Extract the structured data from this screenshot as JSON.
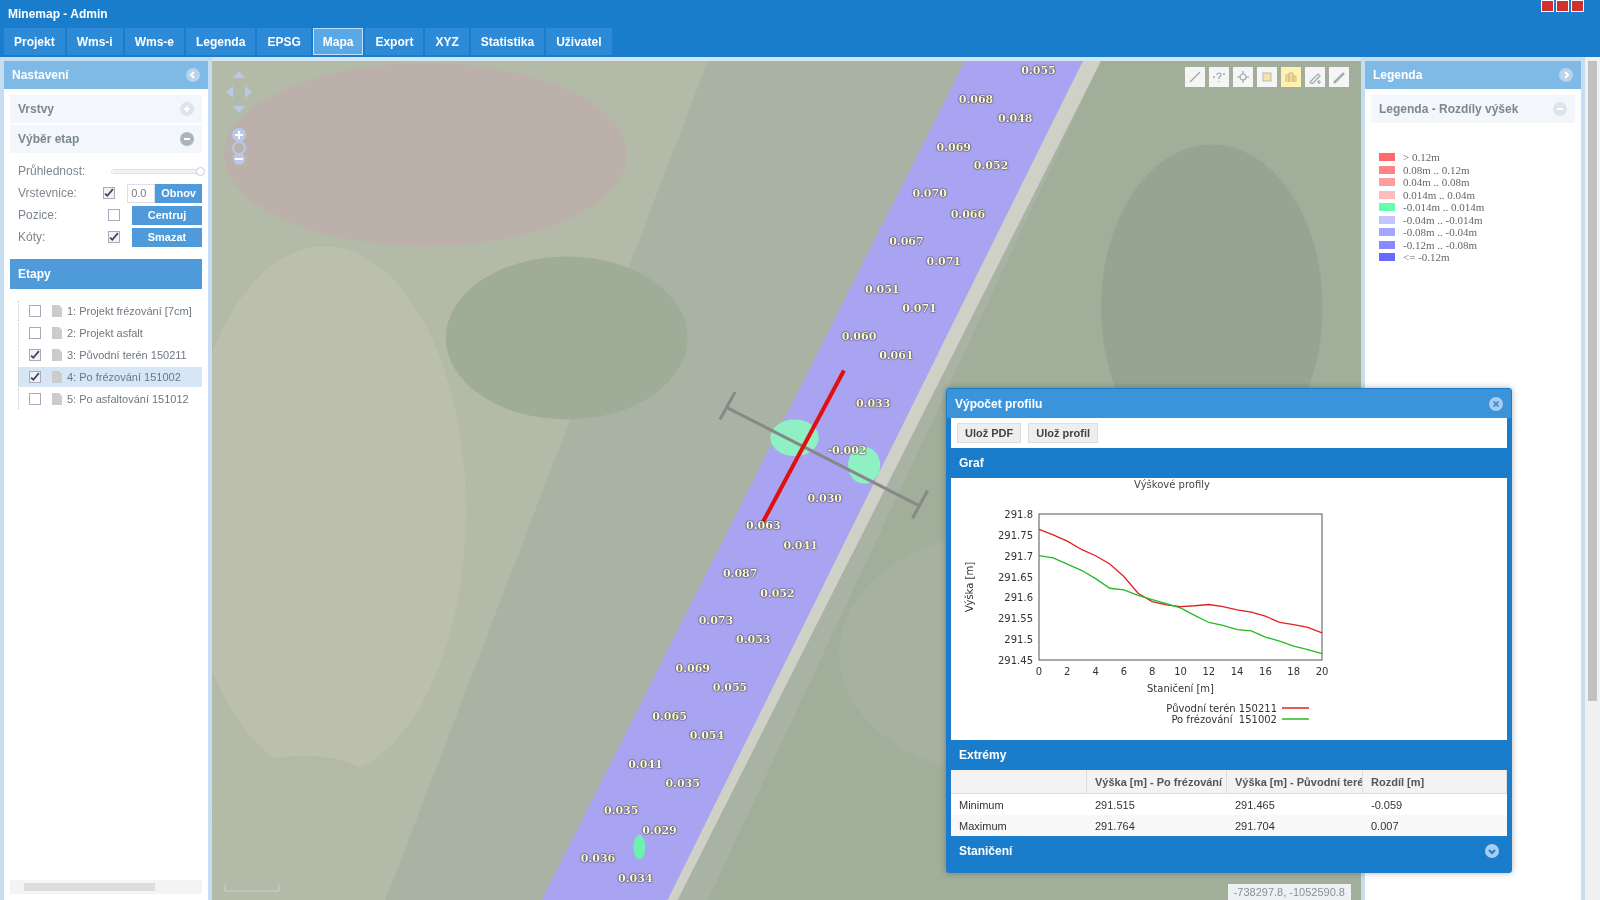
{
  "window": {
    "title": "Minemap - Admin"
  },
  "tabs": [
    {
      "label": "Projekt",
      "selected": false
    },
    {
      "label": "Wms-i",
      "selected": false
    },
    {
      "label": "Wms-e",
      "selected": false
    },
    {
      "label": "Legenda",
      "selected": false
    },
    {
      "label": "EPSG",
      "selected": false
    },
    {
      "label": "Mapa",
      "selected": true
    },
    {
      "label": "Export",
      "selected": false
    },
    {
      "label": "XYZ",
      "selected": false
    },
    {
      "label": "Statistika",
      "selected": false
    },
    {
      "label": "Uživatel",
      "selected": false
    }
  ],
  "left_panel": {
    "title": "Nastavení",
    "sections": [
      {
        "label": "Vrstvy",
        "expanded": false
      },
      {
        "label": "Výběr etap",
        "expanded": true
      }
    ],
    "transparency": {
      "label": "Průhlednost:",
      "level": 1.0
    },
    "rows": [
      {
        "label": "Vrstevnice:",
        "checked": true,
        "value": "0.0",
        "button": "Obnov"
      },
      {
        "label": "Pozice:",
        "checked": false,
        "button": "Centruj"
      },
      {
        "label": "Kóty:",
        "checked": true,
        "button": "Smazat"
      }
    ],
    "stages_title": "Etapy",
    "stages": [
      {
        "label": "1: Projekt frézování [7cm]",
        "checked": false,
        "selected": false
      },
      {
        "label": "2: Projekt asfalt",
        "checked": false,
        "selected": false
      },
      {
        "label": "3: Původní terén 150211",
        "checked": true,
        "selected": false
      },
      {
        "label": "4: Po frézování 151002",
        "checked": true,
        "selected": true
      },
      {
        "label": "5: Po asfaltování 151012",
        "checked": false,
        "selected": false
      }
    ]
  },
  "map": {
    "labels": [
      "0.055",
      "0.068",
      "0.048",
      "0.069",
      "0.052",
      "0.070",
      "0.066",
      "0.067",
      "0.071",
      "0.051",
      "0.071",
      "0.060",
      "0.061",
      "0.033",
      "-0.002",
      "0.030",
      "0.063",
      "0.041",
      "0.087",
      "0.052",
      "0.073",
      "0.053",
      "0.069",
      "0.055",
      "0.065",
      "0.054",
      "0.041",
      "0.035",
      "0.035",
      "0.029",
      "0.036",
      "0.034"
    ],
    "tools": [
      {
        "kind": "line",
        "selected": false
      },
      {
        "kind": "query",
        "selected": false
      },
      {
        "kind": "target",
        "selected": false
      },
      {
        "kind": "square",
        "selected": false
      },
      {
        "kind": "grid",
        "selected": true
      },
      {
        "kind": "pen",
        "selected": false
      },
      {
        "kind": "pencil",
        "selected": false
      }
    ],
    "coordinates": "-738297.8, -1052590.8"
  },
  "right_panel": {
    "title": "Legenda",
    "section": "Legenda - Rozdíly výšek",
    "legend": [
      {
        "label": "> 0.12m",
        "color": "#ff6b6b"
      },
      {
        "label": "0.08m .. 0.12m",
        "color": "#ff8585"
      },
      {
        "label": "0.04m .. 0.08m",
        "color": "#ff9e9e"
      },
      {
        "label": "0.014m .. 0.04m",
        "color": "#ffbcbc"
      },
      {
        "label": "-0.014m .. 0.014m",
        "color": "#66ffb0"
      },
      {
        "label": "-0.04m .. -0.014m",
        "color": "#c4c4ff"
      },
      {
        "label": "-0.08m .. -0.04m",
        "color": "#a6a6ff"
      },
      {
        "label": "-0.12m .. -0.08m",
        "color": "#8888ff"
      },
      {
        "label": "<= -0.12m",
        "color": "#6a6aff"
      }
    ]
  },
  "dialog": {
    "title": "Výpočet profilu",
    "buttons": [
      "Ulož PDF",
      "Ulož profil"
    ],
    "graph_title": "Graf",
    "chart_data": {
      "type": "line",
      "title": "Výškové profily",
      "xlabel": "Staničení [m]",
      "ylabel": "Výška [m]",
      "x": [
        0,
        1,
        2,
        3,
        4,
        5,
        6,
        7,
        8,
        9,
        10,
        11,
        12,
        13,
        14,
        15,
        16,
        17,
        18,
        19,
        20
      ],
      "series": [
        {
          "name": "Původní terén 150211",
          "color": "#e02020",
          "values": [
            291.763,
            291.75,
            291.735,
            291.715,
            291.7,
            291.68,
            291.65,
            291.61,
            291.59,
            291.582,
            291.578,
            291.58,
            291.583,
            291.578,
            291.57,
            291.565,
            291.555,
            291.54,
            291.535,
            291.528,
            291.515
          ]
        },
        {
          "name": "Po frézování  151002",
          "color": "#22bb22",
          "values": [
            291.7,
            291.695,
            291.68,
            291.665,
            291.645,
            291.622,
            291.618,
            291.605,
            291.595,
            291.585,
            291.575,
            291.557,
            291.54,
            291.533,
            291.523,
            291.52,
            291.505,
            291.495,
            291.483,
            291.475,
            291.465
          ]
        }
      ],
      "xlim": [
        0,
        20
      ],
      "ylim": [
        291.45,
        291.8
      ],
      "xticks": [
        0,
        2,
        4,
        6,
        8,
        10,
        12,
        14,
        16,
        18,
        20
      ],
      "yticks": [
        291.45,
        291.5,
        291.55,
        291.6,
        291.65,
        291.7,
        291.75,
        291.8
      ],
      "legend": true
    },
    "extremes_title": "Extrémy",
    "table": {
      "columns": [
        "",
        "Výška [m] - Po frézování",
        "Výška [m] - Původní teré",
        "Rozdíl [m]"
      ],
      "rows": [
        [
          "Minimum",
          "291.515",
          "291.465",
          "-0.059"
        ],
        [
          "Maximum",
          "291.764",
          "291.704",
          "0.007"
        ]
      ]
    },
    "stations": {
      "title": "Staničení",
      "expanded": false
    }
  }
}
